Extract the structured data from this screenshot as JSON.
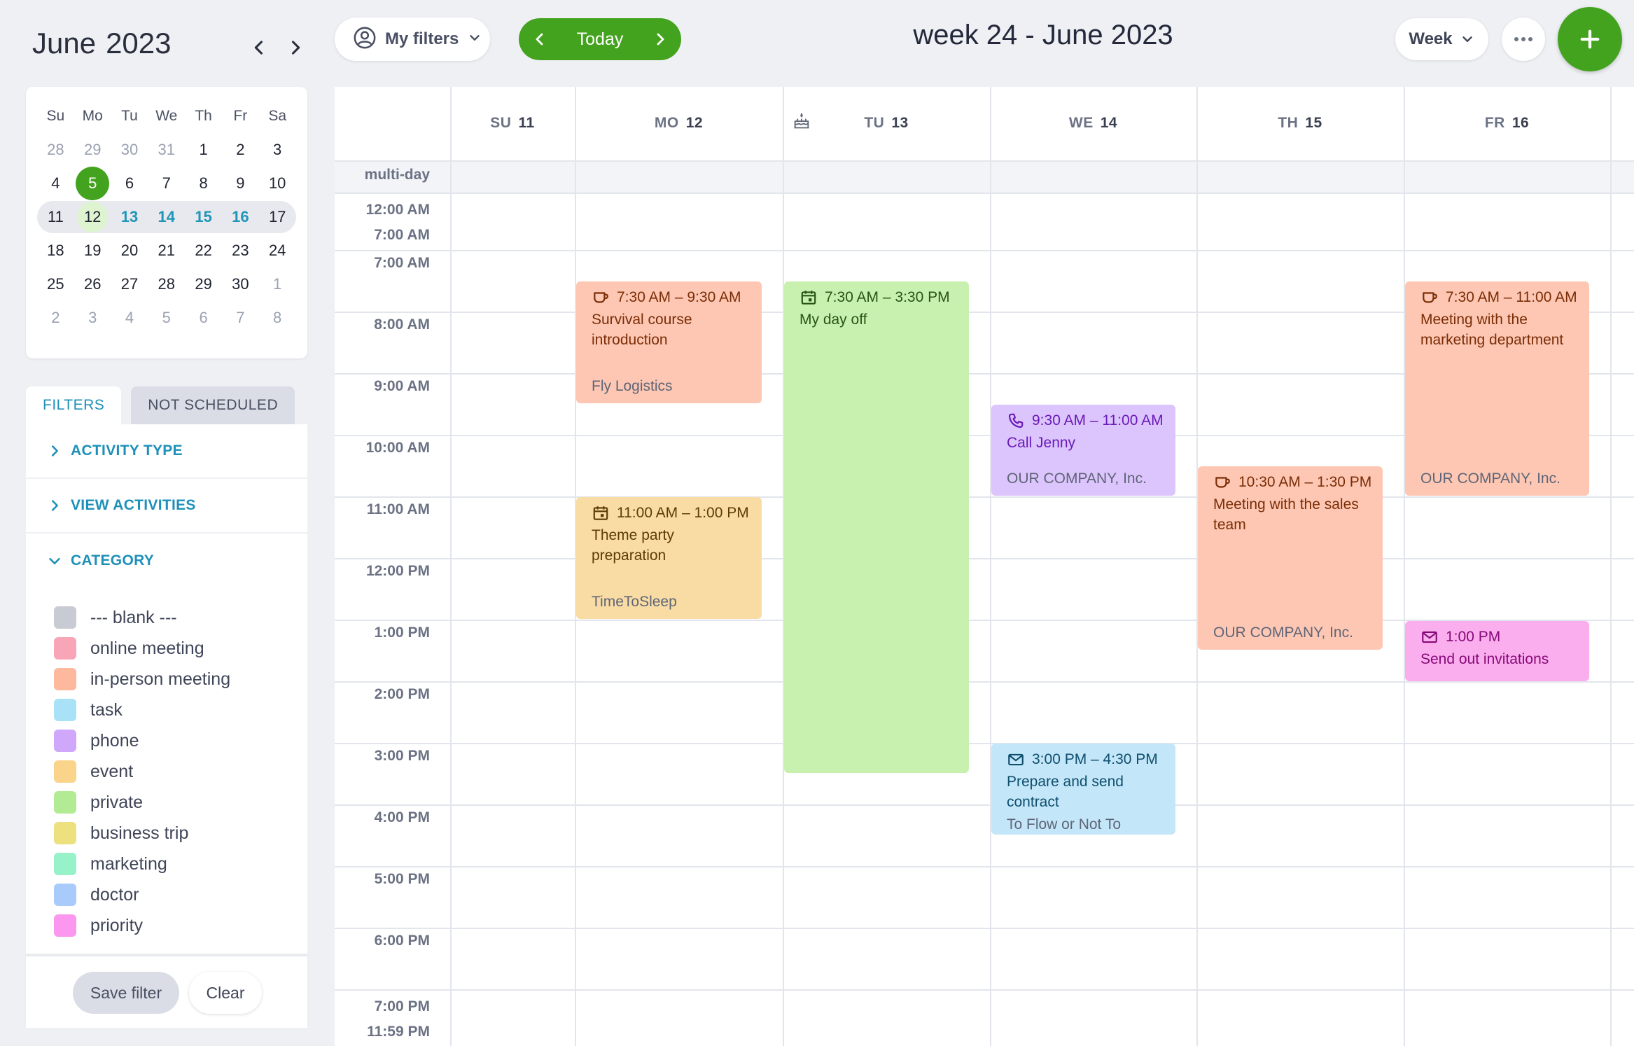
{
  "mini_calendar": {
    "month": "June",
    "year": "2023",
    "weekdays": [
      "Su",
      "Mo",
      "Tu",
      "We",
      "Th",
      "Fr",
      "Sa"
    ],
    "weeks": [
      [
        "28",
        "29",
        "30",
        "31",
        "1",
        "2",
        "3"
      ],
      [
        "4",
        "5",
        "6",
        "7",
        "8",
        "9",
        "10"
      ],
      [
        "11",
        "12",
        "13",
        "14",
        "15",
        "16",
        "17"
      ],
      [
        "18",
        "19",
        "20",
        "21",
        "22",
        "23",
        "24"
      ],
      [
        "25",
        "26",
        "27",
        "28",
        "29",
        "30",
        "1"
      ],
      [
        "2",
        "3",
        "4",
        "5",
        "6",
        "7",
        "8"
      ]
    ]
  },
  "filters_panel": {
    "tab_filters": "FILTERS",
    "tab_not_scheduled": "NOT SCHEDULED",
    "sections": {
      "activity_type": "ACTIVITY TYPE",
      "view_activities": "VIEW ACTIVITIES",
      "category": "CATEGORY"
    },
    "categories": [
      {
        "label": "--- blank ---",
        "color": "#c8cbd3"
      },
      {
        "label": "online meeting",
        "color": "#f9a5b8"
      },
      {
        "label": "in-person meeting",
        "color": "#fdb89e"
      },
      {
        "label": "task",
        "color": "#a9e2f7"
      },
      {
        "label": "phone",
        "color": "#cfa8fb"
      },
      {
        "label": "event",
        "color": "#fad48a"
      },
      {
        "label": "private",
        "color": "#b3eb94"
      },
      {
        "label": "business trip",
        "color": "#ece07f"
      },
      {
        "label": "marketing",
        "color": "#97f1c9"
      },
      {
        "label": "doctor",
        "color": "#a9cbfb"
      },
      {
        "label": "priority",
        "color": "#fb97ee"
      }
    ],
    "save_filter": "Save filter",
    "clear": "Clear"
  },
  "toolbar": {
    "my_filters": "My filters",
    "today": "Today",
    "week_title": "week 24 - June 2023",
    "view_mode": "Week"
  },
  "calendar": {
    "days": [
      {
        "dow": "SU",
        "num": "11"
      },
      {
        "dow": "MO",
        "num": "12"
      },
      {
        "dow": "TU",
        "num": "13"
      },
      {
        "dow": "WE",
        "num": "14"
      },
      {
        "dow": "TH",
        "num": "15"
      },
      {
        "dow": "FR",
        "num": "16"
      }
    ],
    "multiday_label": "multi-day",
    "time_labels": {
      "collapsed_start": "12:00 AM",
      "collapsed_end": "7:00 AM",
      "h7": "7:00 AM",
      "h8": "8:00 AM",
      "h9": "9:00 AM",
      "h10": "10:00 AM",
      "h11": "11:00 AM",
      "h12": "12:00 PM",
      "h13": "1:00 PM",
      "h14": "2:00 PM",
      "h15": "3:00 PM",
      "h16": "4:00 PM",
      "h17": "5:00 PM",
      "h18": "6:00 PM",
      "late_start": "7:00 PM",
      "late_end": "11:59 PM"
    },
    "events": {
      "survival": {
        "time": "7:30 AM – 9:30 AM",
        "title": "Survival course introduction",
        "org": "Fly Logistics",
        "category": "in-person meeting"
      },
      "theme_party": {
        "time": "11:00 AM – 1:00 PM",
        "title": "Theme party preparation",
        "org": "TimeToSleep",
        "category": "event"
      },
      "day_off": {
        "time": "7:30 AM – 3:30 PM",
        "title": "My day off",
        "category": "private"
      },
      "call_jenny": {
        "time": "9:30 AM – 11:00 AM",
        "title": "Call Jenny",
        "org": "OUR COMPANY, Inc.",
        "category": "phone"
      },
      "contract": {
        "time": "3:00 PM – 4:30 PM",
        "title": "Prepare and send contract",
        "org": "To Flow or Not To",
        "category": "task"
      },
      "sales": {
        "time": "10:30 AM – 1:30 PM",
        "title": "Meeting with the sales team",
        "org": "OUR COMPANY, Inc.",
        "category": "in-person meeting"
      },
      "marketing": {
        "time": "7:30 AM – 11:00 AM",
        "title": "Meeting with the marketing department",
        "org": "OUR COMPANY, Inc.",
        "category": "in-person meeting"
      },
      "invitations": {
        "time": "1:00 PM",
        "title": "Send out invitations",
        "category": "priority"
      }
    }
  }
}
